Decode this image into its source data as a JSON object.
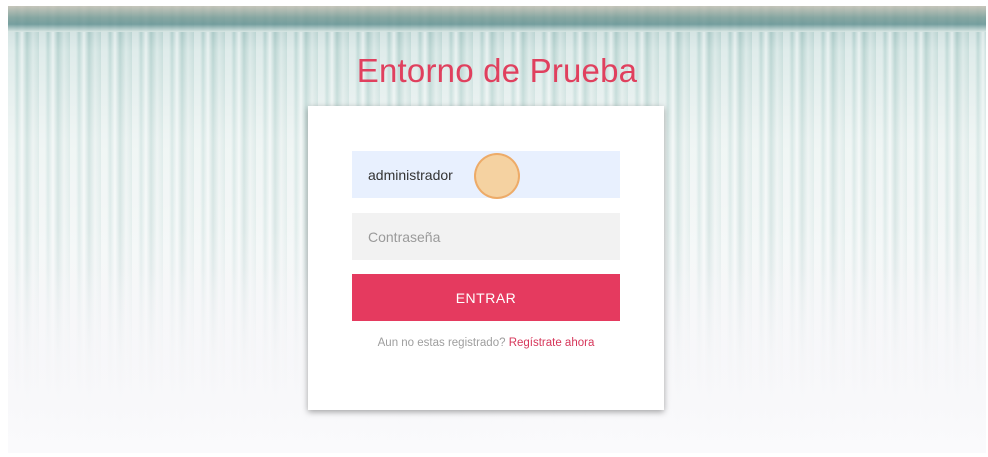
{
  "page": {
    "title": "Entorno de Prueba"
  },
  "login": {
    "username_value": "administrador",
    "password_placeholder": "Contraseña",
    "submit_label": "ENTRAR",
    "register_prompt": "Aun no estas registrado?",
    "register_link": "Regístrate ahora"
  },
  "colors": {
    "accent": "#e53a5f",
    "title": "#e0405e",
    "username_bg": "#e8f0fe",
    "password_bg": "#f2f2f2"
  }
}
